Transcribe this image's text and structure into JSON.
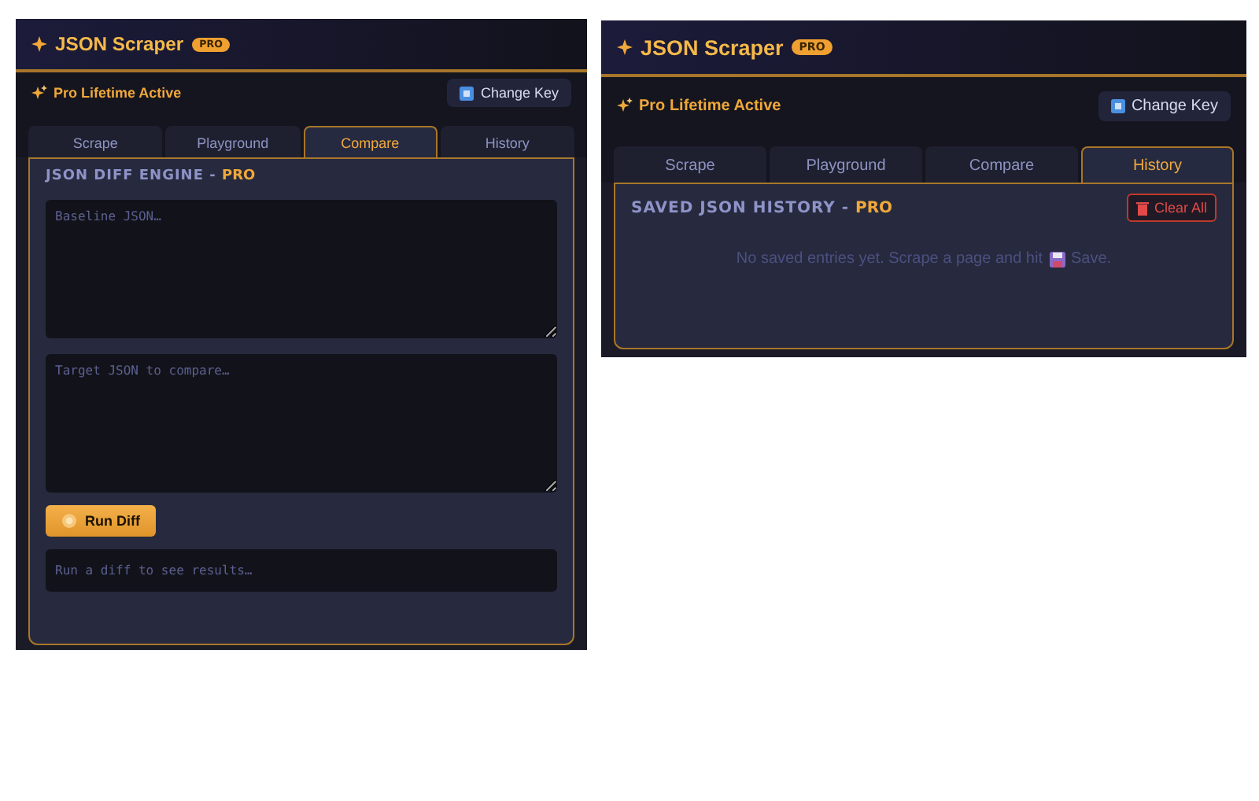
{
  "panels": [
    {
      "title": "JSON Scraper",
      "badge": "PRO",
      "status": "Pro Lifetime Active",
      "key_button": "Change Key",
      "tabs": [
        {
          "label": "Scrape",
          "selected": false
        },
        {
          "label": "Playground",
          "selected": false
        },
        {
          "label": "Compare",
          "selected": true
        },
        {
          "label": "History",
          "selected": false
        }
      ],
      "content": {
        "kind": "diff",
        "title": "JSON DIFF ENGINE -",
        "title_accent": "PRO",
        "fields": [
          {
            "placeholder": "Baseline JSON…"
          },
          {
            "placeholder": "Target JSON to compare…"
          }
        ],
        "button": "Run Diff",
        "output": "Run a diff to see results…"
      }
    },
    {
      "title": "JSON Scraper",
      "badge": "PRO",
      "status": "Pro Lifetime Active",
      "key_button": "Change Key",
      "tabs": [
        {
          "label": "Scrape",
          "selected": false
        },
        {
          "label": "Playground",
          "selected": false
        },
        {
          "label": "Compare",
          "selected": false
        },
        {
          "label": "History",
          "selected": true
        }
      ],
      "content": {
        "kind": "history",
        "title": "SAVED JSON HISTORY -",
        "title_accent": "PRO",
        "button": "Clear All",
        "empty_before": "No saved entries yet. Scrape a page and hit",
        "empty_after": "Save."
      }
    }
  ]
}
